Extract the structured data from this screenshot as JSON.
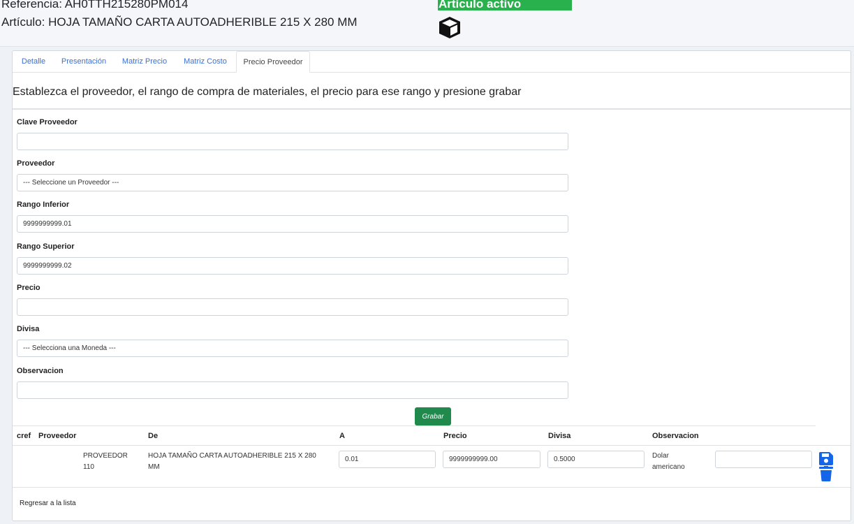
{
  "header": {
    "reference": "Referencia: AH0TTH215280PM014",
    "article": "Artículo: HOJA TAMAÑO CARTA AUTOADHERIBLE 215 X 280 MM",
    "status_badge": "Artículo activo"
  },
  "tabs": [
    {
      "label": "Detalle"
    },
    {
      "label": "Presentación"
    },
    {
      "label": "Matriz Precio"
    },
    {
      "label": "Matriz Costo"
    },
    {
      "label": "Precio Proveedor",
      "active": true
    }
  ],
  "instructions": "Establezca el proveedor, el rango de compra de materiales, el precio para ese rango y presione grabar",
  "form": {
    "clave_proveedor": {
      "label": "Clave Proveedor",
      "value": ""
    },
    "proveedor": {
      "label": "Proveedor",
      "value": "--- Seleccione un Proveedor ---"
    },
    "rango_inferior": {
      "label": "Rango Inferior",
      "value": "9999999999.01"
    },
    "rango_superior": {
      "label": "Rango Superior",
      "value": "9999999999.02"
    },
    "precio": {
      "label": "Precio",
      "value": ""
    },
    "divisa": {
      "label": "Divisa",
      "value": "--- Selecciona una Moneda ---"
    },
    "observacion": {
      "label": "Observacion",
      "value": ""
    },
    "save_label": "Grabar"
  },
  "table": {
    "headers": [
      "cref",
      "Proveedor",
      "De",
      "A",
      "Precio",
      "Divisa",
      "Observacion"
    ],
    "rows": [
      {
        "proveedor": "PROVEEDOR 110",
        "de": "HOJA TAMAÑO CARTA AUTOADHERIBLE 215 X 280 MM",
        "a": "0.01",
        "precio": "9999999999.00",
        "divisa": "0.5000",
        "observacion": "Dolar americano",
        "extra": ""
      }
    ]
  },
  "back_link": "Regresar a la lista",
  "colors": {
    "accent": "#1f8a4c",
    "badge": "#28b14c",
    "icon_blue": "#1565e8",
    "tab_link": "#3b6fd6"
  },
  "icons": [
    "box-icon",
    "floppy-disk-icon",
    "trash-icon"
  ]
}
